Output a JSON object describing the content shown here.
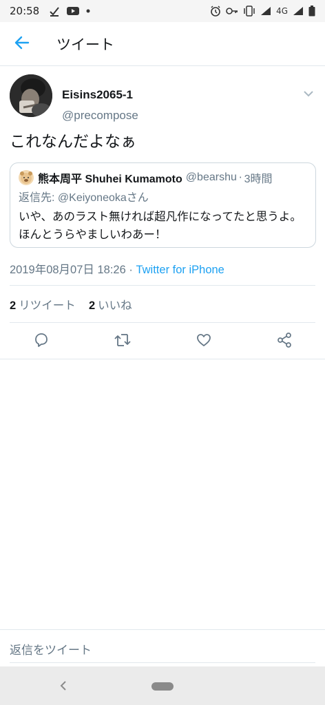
{
  "status_bar": {
    "time": "20:58",
    "network": "4G"
  },
  "app_bar": {
    "title": "ツイート",
    "back_icon": "arrow-left-icon",
    "accent": "#1da1f2"
  },
  "tweet": {
    "display_name": "Eisins2065-1",
    "handle": "@precompose",
    "text": "これなんだよなぁ",
    "quoted": {
      "display_name": "熊本周平 Shuhei Kumamoto",
      "handle": "@bearshu",
      "separator": "·",
      "time": "3時間",
      "reply_prefix": "返信先: ",
      "reply_to": "@Keiyoneokaさん",
      "body": "いや、あのラスト無ければ超凡作になってたと思うよ。ほんとうらやましいわあー！"
    },
    "timestamp": "2019年08月07日 18:26",
    "meta_separator": " · ",
    "source": "Twitter for iPhone",
    "stats": {
      "retweets_count": "2",
      "retweets_label": "リツイート",
      "likes_count": "2",
      "likes_label": "いいね"
    },
    "actions": [
      "reply-icon",
      "retweet-icon",
      "like-icon",
      "share-icon"
    ]
  },
  "reply_bar": {
    "placeholder": "返信をツイート"
  }
}
